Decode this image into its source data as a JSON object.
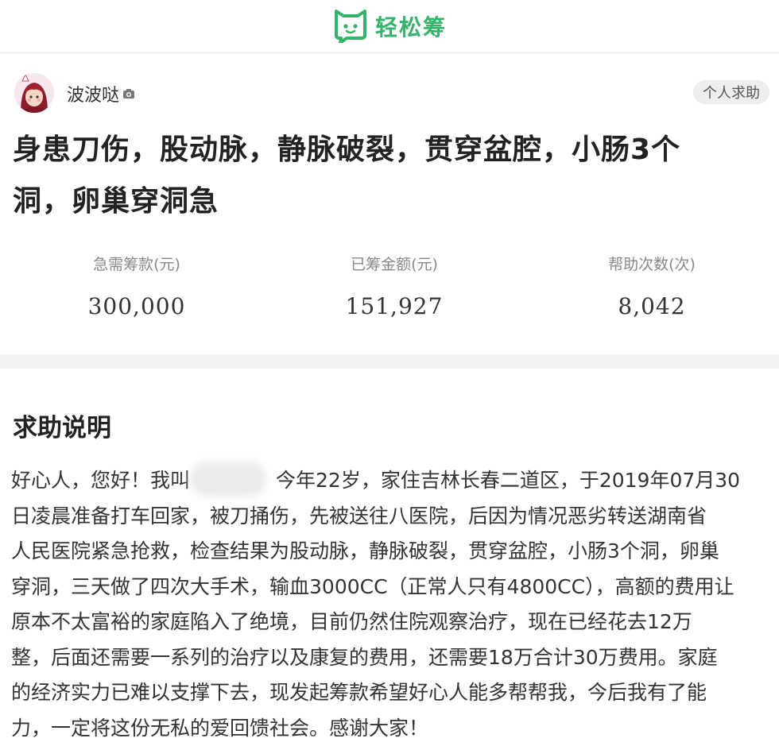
{
  "header": {
    "logo_text": "轻松筹",
    "logo_icon": "cat-face-icon",
    "brand_color": "#35b36b"
  },
  "post": {
    "username": "波波哒",
    "badge": "个人求助",
    "title_lines": [
      "身患刀伤，股动脉，静脉破裂，贯穿盆腔，小肠3个",
      "洞，卵巢穿洞急"
    ]
  },
  "stats": [
    {
      "label": "急需筹款(元)",
      "value": "300,000"
    },
    {
      "label": "已筹金额(元)",
      "value": "151,927"
    },
    {
      "label": "帮助次数(次)",
      "value": "8,042"
    }
  ],
  "description": {
    "heading": "求助说明",
    "line1_before": "好心人，您好！我叫",
    "line1_after": "今年22岁，家住吉林长春二道区，于2019年07月30",
    "lines": [
      "日凌晨准备打车回家，被刀捅伤，先被送往八医院，后因为情况恶劣转送湖南省",
      "人民医院紧急抢救，检查结果为股动脉，静脉破裂，贯穿盆腔，小肠3个洞，卵巢",
      "穿洞，三天做了四次大手术，输血3000CC（正常人只有4800CC），高额的费用让",
      "原本不太富裕的家庭陷入了绝境，目前仍然住院观察治疗，现在已经花去12万",
      "整，后面还需要一系列的治疗以及康复的费用，还需要18万合计30万费用。家庭",
      "的经济实力已难以支撑下去，现发起筹款希望好心人能多帮帮我，今后我有了能",
      "力，一定将这份无私的爱回馈社会。感谢大家！"
    ]
  }
}
